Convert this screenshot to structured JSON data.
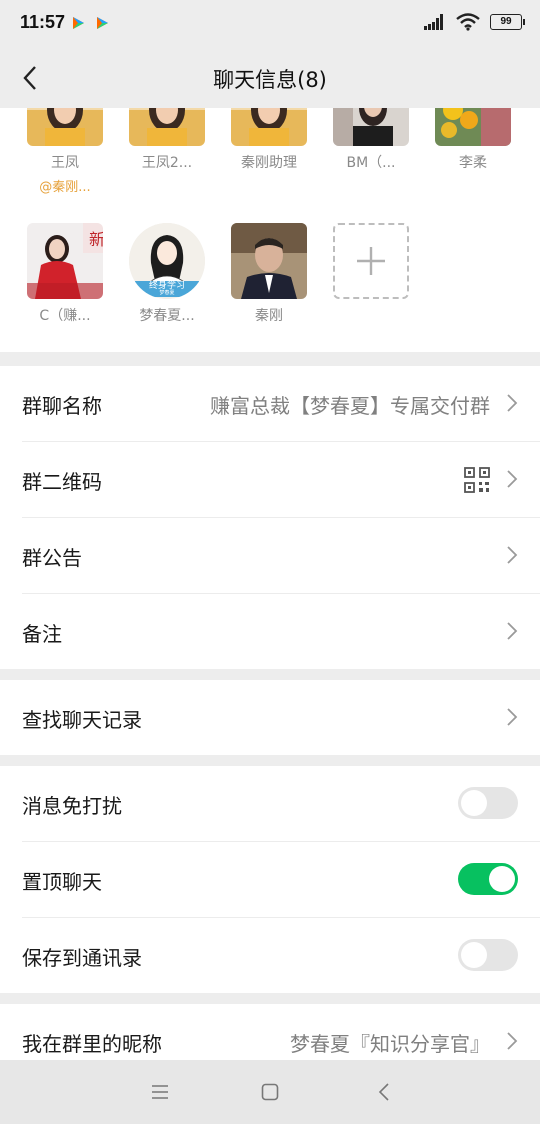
{
  "status_bar": {
    "time": "11:57",
    "battery": "99",
    "app_icons": [
      "tencent-video-icon",
      "tencent-video-icon"
    ]
  },
  "header": {
    "title": "聊天信息(8)"
  },
  "members": [
    {
      "name": "王凤",
      "sub": "@秦刚...",
      "avatar": "woman-yellow-photo"
    },
    {
      "name": "王凤2...",
      "avatar": "woman-yellow-photo"
    },
    {
      "name": "秦刚助理",
      "avatar": "woman-yellow-photo"
    },
    {
      "name": "BM（...",
      "avatar": "woman-dark-photo"
    },
    {
      "name": "李柔",
      "avatar": "flowers-photo"
    },
    {
      "name": "C（赚...",
      "avatar": "woman-red-photo"
    },
    {
      "name": "梦春夏...",
      "avatar": "cartoon-woman",
      "avatar_text": "终身学习",
      "avatar_subtext": "梦春夏"
    },
    {
      "name": "秦刚",
      "avatar": "man-suit-photo"
    }
  ],
  "add_member": {
    "icon": "plus-icon"
  },
  "group_info": {
    "group_name_label": "群聊名称",
    "group_name_value": "赚富总裁【梦春夏】专属交付群",
    "qr_label": "群二维码",
    "notice_label": "群公告",
    "remark_label": "备注"
  },
  "search": {
    "label": "查找聊天记录"
  },
  "settings": {
    "mute_label": "消息免打扰",
    "mute_on": false,
    "pin_label": "置顶聊天",
    "pin_on": true,
    "save_label": "保存到通讯录",
    "save_on": false
  },
  "nickname": {
    "label": "我在群里的昵称",
    "value": "梦春夏『知识分享官』"
  },
  "colors": {
    "accent_green": "#07c160",
    "mention_orange": "#e6a13a",
    "background": "#ededed"
  }
}
